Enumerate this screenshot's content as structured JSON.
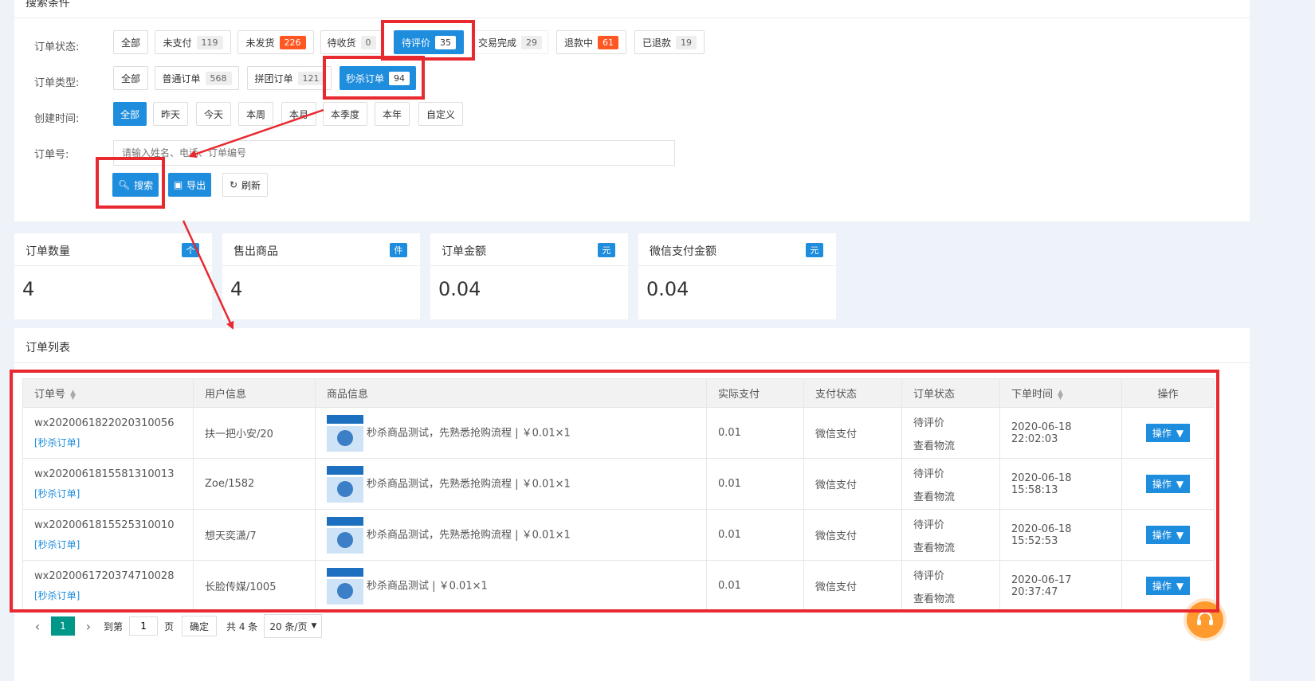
{
  "search": {
    "section_title": "搜索条件",
    "order_status_label": "订单状态:",
    "order_type_label": "订单类型:",
    "created_time_label": "创建时间:",
    "order_no_label": "订单号:",
    "order_status_options": [
      {
        "label": "全部",
        "count": ""
      },
      {
        "label": "未支付",
        "count": "119"
      },
      {
        "label": "未发货",
        "count": "226"
      },
      {
        "label": "待收货",
        "count": "0"
      },
      {
        "label": "待评价",
        "count": "35"
      },
      {
        "label": "交易完成",
        "count": "29"
      },
      {
        "label": "退款中",
        "count": "61"
      },
      {
        "label": "已退款",
        "count": "19"
      }
    ],
    "order_type_options": [
      {
        "label": "全部",
        "count": ""
      },
      {
        "label": "普通订单",
        "count": "568"
      },
      {
        "label": "拼团订单",
        "count": "121"
      },
      {
        "label": "秒杀订单",
        "count": "94"
      }
    ],
    "time_options": [
      "全部",
      "昨天",
      "今天",
      "本周",
      "本月",
      "本季度",
      "本年",
      "自定义"
    ],
    "order_no_placeholder": "请输入姓名、电话、订单编号",
    "search_button": "搜索",
    "export_button": "导出",
    "refresh_button": "刷新"
  },
  "stats": [
    {
      "title": "订单数量",
      "unit": "个",
      "value": "4"
    },
    {
      "title": "售出商品",
      "unit": "件",
      "value": "4"
    },
    {
      "title": "订单金额",
      "unit": "元",
      "value": "0.04"
    },
    {
      "title": "微信支付金额",
      "unit": "元",
      "value": "0.04"
    }
  ],
  "orders": {
    "section_title": "订单列表",
    "columns": [
      "订单号",
      "用户信息",
      "商品信息",
      "实际支付",
      "支付状态",
      "订单状态",
      "下单时间",
      "操作"
    ],
    "rows": [
      {
        "order_no": "wx2020061822020310056",
        "tag": "[秒杀订单]",
        "user": "扶一把小安/20",
        "product": "秒杀商品测试，先熟悉抢购流程 | ￥0.01×1",
        "paid": "0.01",
        "pay_status": "微信支付",
        "status": "待评价",
        "status_link": "查看物流",
        "time": "2020-06-18 22:02:03",
        "action": "操作"
      },
      {
        "order_no": "wx2020061815581310013",
        "tag": "[秒杀订单]",
        "user": "Zoe/1582",
        "product": "秒杀商品测试，先熟悉抢购流程 | ￥0.01×1",
        "paid": "0.01",
        "pay_status": "微信支付",
        "status": "待评价",
        "status_link": "查看物流",
        "time": "2020-06-18 15:58:13",
        "action": "操作"
      },
      {
        "order_no": "wx2020061815525310010",
        "tag": "[秒杀订单]",
        "user": "想天奕潇/7",
        "product": "秒杀商品测试，先熟悉抢购流程 | ￥0.01×1",
        "paid": "0.01",
        "pay_status": "微信支付",
        "status": "待评价",
        "status_link": "查看物流",
        "time": "2020-06-18 15:52:53",
        "action": "操作"
      },
      {
        "order_no": "wx2020061720374710028",
        "tag": "[秒杀订单]",
        "user": "长脸传媒/1005",
        "product": "秒杀商品测试 | ￥0.01×1",
        "paid": "0.01",
        "pay_status": "微信支付",
        "status": "待评价",
        "status_link": "查看物流",
        "time": "2020-06-17 20:37:47",
        "action": "操作"
      }
    ]
  },
  "pagination": {
    "current_page": "1",
    "goto_label": "到第",
    "goto_value": "1",
    "page_unit": "页",
    "confirm": "确定",
    "total": "共 4 条",
    "page_size": "20 条/页"
  },
  "colors": {
    "primary": "#1f8dde",
    "orange": "#ff5722",
    "annotation_red": "#e8292f",
    "pager_active": "#009688"
  }
}
